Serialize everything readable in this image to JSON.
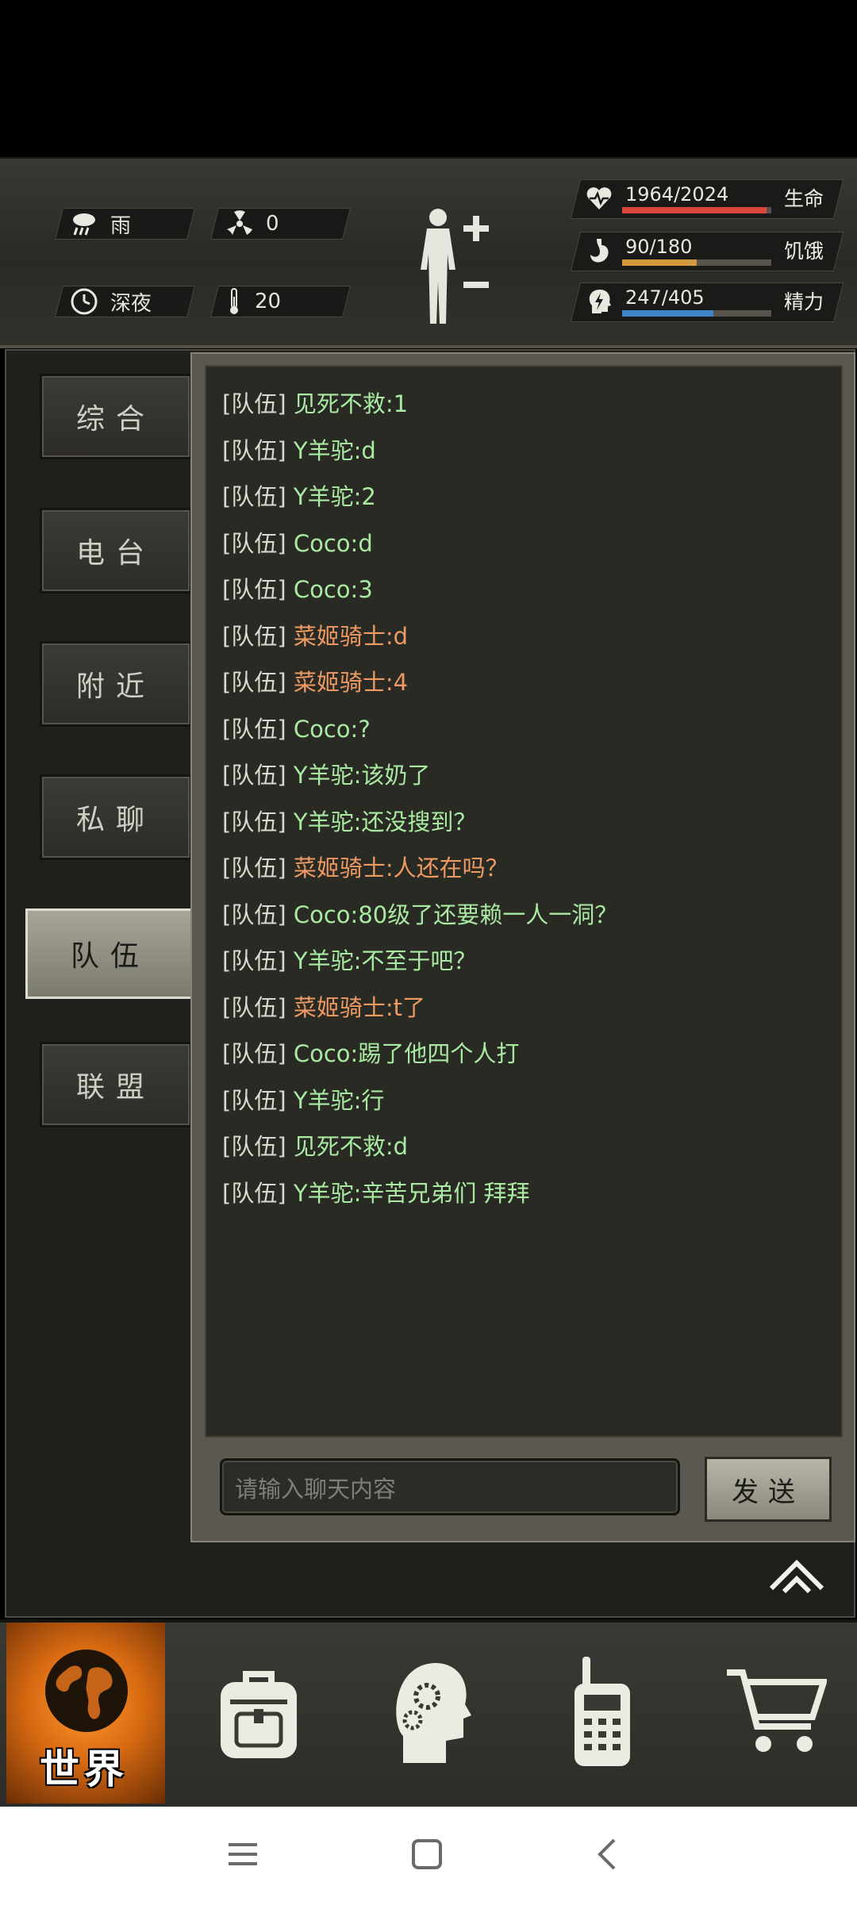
{
  "status": {
    "weather": "雨",
    "radiation": "0",
    "time_of_day": "深夜",
    "temperature": "20"
  },
  "bars": {
    "health": {
      "value": "1964/2024",
      "label": "生命",
      "fraction": 0.97,
      "color": "#d9473f"
    },
    "hunger": {
      "value": "90/180",
      "label": "饥饿",
      "fraction": 0.5,
      "color": "#d59a3d"
    },
    "energy": {
      "value": "247/405",
      "label": "精力",
      "fraction": 0.61,
      "color": "#3f86c9"
    }
  },
  "tabs": [
    "综合",
    "电台",
    "附近",
    "私聊",
    "队伍",
    "联盟"
  ],
  "active_tab": "队伍",
  "messages": [
    {
      "tag": "[队伍]",
      "name": "见死不救",
      "text": ":1",
      "color": "green"
    },
    {
      "tag": "[队伍]",
      "name": "Y羊驼",
      "text": ":d",
      "color": "green"
    },
    {
      "tag": "[队伍]",
      "name": "Y羊驼",
      "text": ":2",
      "color": "green"
    },
    {
      "tag": "[队伍]",
      "name": "Coco",
      "text": ":d",
      "color": "green"
    },
    {
      "tag": "[队伍]",
      "name": "Coco",
      "text": ":3",
      "color": "green"
    },
    {
      "tag": "[队伍]",
      "name": "菜姬骑士",
      "text": ":d",
      "color": "orange"
    },
    {
      "tag": "[队伍]",
      "name": "菜姬骑士",
      "text": ":4",
      "color": "orange"
    },
    {
      "tag": "[队伍]",
      "name": "Coco",
      "text": ":?",
      "color": "green"
    },
    {
      "tag": "[队伍]",
      "name": "Y羊驼",
      "text": ":该奶了",
      "color": "green"
    },
    {
      "tag": "[队伍]",
      "name": "Y羊驼",
      "text": ":还没搜到？",
      "color": "green"
    },
    {
      "tag": "[队伍]",
      "name": "菜姬骑士",
      "text": ":人还在吗？",
      "color": "orange"
    },
    {
      "tag": "[队伍]",
      "name": "Coco",
      "text": ":80级了还要赖一人一洞？",
      "color": "green"
    },
    {
      "tag": "[队伍]",
      "name": "Y羊驼",
      "text": ":不至于吧？",
      "color": "green"
    },
    {
      "tag": "[队伍]",
      "name": "菜姬骑士",
      "text": ":t了",
      "color": "orange"
    },
    {
      "tag": "[队伍]",
      "name": "Coco",
      "text": ":踢了他四个人打",
      "color": "green"
    },
    {
      "tag": "[队伍]",
      "name": "Y羊驼",
      "text": ":行",
      "color": "green"
    },
    {
      "tag": "[队伍]",
      "name": "见死不救",
      "text": ":d",
      "color": "green"
    },
    {
      "tag": "[队伍]",
      "name": "Y羊驼",
      "text": ":辛苦兄弟们 拜拜",
      "color": "green"
    }
  ],
  "input": {
    "placeholder": "请输入聊天内容",
    "send_label": "发送"
  },
  "nav": {
    "world_label": "世界"
  }
}
